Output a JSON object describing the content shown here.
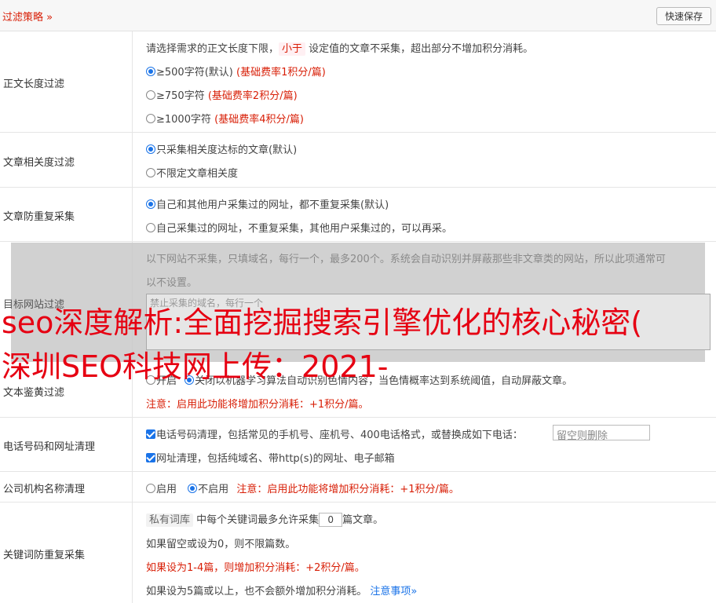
{
  "header": {
    "title": "过滤策略 »",
    "save_button": "快速保存"
  },
  "rows": {
    "content_length": {
      "label": "正文长度过滤",
      "desc_prefix": "请选择需求的正文长度下限，",
      "desc_tag": "小于",
      "desc_suffix": "设定值的文章不采集，超出部分不增加积分消耗。",
      "options": [
        {
          "text": "≥500字符(默认)",
          "note": "(基础费率1积分/篇)",
          "checked": true
        },
        {
          "text": "≥750字符",
          "note": "(基础费率2积分/篇)",
          "checked": false
        },
        {
          "text": "≥1000字符",
          "note": "(基础费率4积分/篇)",
          "checked": false
        }
      ]
    },
    "relevance": {
      "label": "文章相关度过滤",
      "options": [
        {
          "text": "只采集相关度达标的文章(默认)",
          "checked": true
        },
        {
          "text": "不限定文章相关度",
          "checked": false
        }
      ]
    },
    "dedupe": {
      "label": "文章防重复采集",
      "options": [
        {
          "text": "自己和其他用户采集过的网址，都不重复采集(默认)",
          "checked": true
        },
        {
          "text": "自己采集过的网址，不重复采集，其他用户采集过的，可以再采。",
          "checked": false
        }
      ]
    },
    "target_site": {
      "label": "目标网站过滤",
      "desc_line1": "以下网站不采集，只填域名，每行一个，最多200个。系统会自动识别并屏蔽那些非文章类的网站，所以此项通常可",
      "desc_line2": "以不设置。",
      "placeholder": "禁止采集的域名，每行一个"
    },
    "porn": {
      "label": "文本鉴黄过滤",
      "opt_on": "开启",
      "opt_off": "关闭",
      "desc": "以机器学习算法自动识别色情内容，当色情概率达到系统阈值，自动屏蔽文章。",
      "note": "注意：启用此功能将增加积分消耗：+1积分/篇。"
    },
    "phone": {
      "label": "电话号码和网址清理",
      "phone_text": "电话号码清理，包括常见的手机号、座机号、400电话格式，或替换成如下电话：",
      "phone_placeholder": "留空则删除",
      "url_text": "网址清理，包括纯域名、带http(s)的网址、电子邮箱"
    },
    "org": {
      "label": "公司机构名称清理",
      "opt_on": "启用",
      "opt_off": "不启用",
      "note": "注意：启用此功能将增加积分消耗：+1积分/篇。"
    },
    "keyword": {
      "label": "关键词防重复采集",
      "tag": "私有词库",
      "line1_a": "中每个关键词最多允许采集",
      "value": "0",
      "line1_b": "篇文章。",
      "line2": "如果留空或设为0，则不限篇数。",
      "line3": "如果设为1-4篇，则增加积分消耗：+2积分/篇。",
      "line4": "如果设为5篇或以上，也不会额外增加积分消耗。",
      "notice_link": "注意事项»"
    }
  },
  "overlay": {
    "line1": "seo深度解析:全面挖掘搜索引擎优化的核心秘密(",
    "line2": "深圳SEO科技网上传：2021-"
  },
  "colors": {
    "accent_red": "#d81e06",
    "radio_blue": "#1a73e8"
  }
}
